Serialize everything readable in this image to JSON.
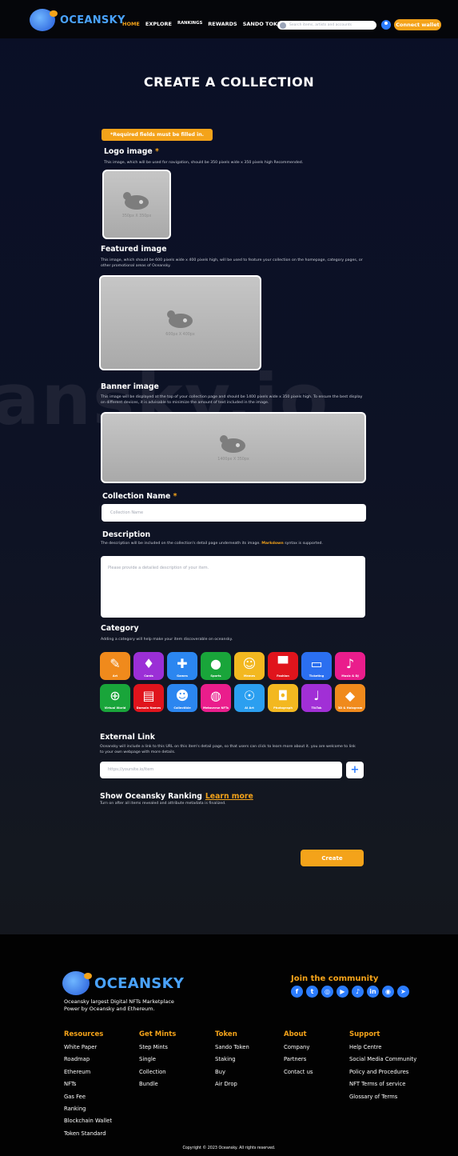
{
  "header": {
    "brand": "OCEANSKY",
    "nav": [
      {
        "label": "HOME",
        "active": true
      },
      {
        "label": "EXPLORE",
        "active": false
      },
      {
        "label": "RANKINGS",
        "active": false
      },
      {
        "label": "REWARDS",
        "active": false
      },
      {
        "label": "SANDO TOKEN",
        "active": false
      }
    ],
    "search_placeholder": "Search items, artists and accounts",
    "connect_label": "Connect wallet"
  },
  "watermark": "ansky.io",
  "page_title": "CREATE  A COLLECTION",
  "required_note": "*Required fields must be filled in.",
  "logo_image": {
    "title": "Logo image",
    "required_mark": "*",
    "desc": "This image, which will be used for navigation, should be 350 pixels wide x 350 pixels high Recommended.",
    "size_hint": "350px X 350px"
  },
  "featured_image": {
    "title": "Featured image",
    "desc": "This image, which should be 600 pixels wide x 400 pixels high, will be used to feature your collection on the homepage, category pages, or other promotional areas of Oceansky.",
    "size_hint": "600px X 400px"
  },
  "banner_image": {
    "title": "Banner image",
    "desc": "This image will be displayed at the top of your collection page and should be 1400 pixels wide x 350 pixels high. To ensure the best display on different devices, it is advisable to minimize the amount of text included in the image.",
    "size_hint": "1400px X 350px"
  },
  "collection_name": {
    "title": "Collection Name",
    "required_mark": "*",
    "placeholder": "Collection Name"
  },
  "description": {
    "title": "Description",
    "desc_before": "The description will be included on the collection's detail page underneath its image. ",
    "desc_link": "Markdown",
    "desc_after": " syntax is supported.",
    "placeholder": "Please provide a detailed description of your item."
  },
  "category": {
    "title": "Category",
    "desc": "Adding a category will help make your item discoverable on oceansky.",
    "items": [
      {
        "label": "Art",
        "color": "#f08a1c",
        "icon": "palette-icon",
        "glyph": "✎"
      },
      {
        "label": "Cards",
        "color": "#9b2fd6",
        "icon": "cards-icon",
        "glyph": "♦"
      },
      {
        "label": "Games",
        "color": "#2b86f0",
        "icon": "gamepad-icon",
        "glyph": "✚"
      },
      {
        "label": "Sports",
        "color": "#19a53a",
        "icon": "ball-icon",
        "glyph": "●"
      },
      {
        "label": "Memes",
        "color": "#f3b820",
        "icon": "doge-icon",
        "glyph": "☺"
      },
      {
        "label": "Fashion",
        "color": "#e0141c",
        "icon": "hat-icon",
        "glyph": "▀"
      },
      {
        "label": "Ticketing",
        "color": "#2b6ff0",
        "icon": "ticket-icon",
        "glyph": "▭"
      },
      {
        "label": "Music & DJ",
        "color": "#ea1d8c",
        "icon": "music-icon",
        "glyph": "♪"
      },
      {
        "label": "Virtual World",
        "color": "#19a53a",
        "icon": "globe-icon",
        "glyph": "⊕"
      },
      {
        "label": "Domain Names",
        "color": "#e0141c",
        "icon": "www-icon",
        "glyph": "▤"
      },
      {
        "label": "Collectible",
        "color": "#2b86f0",
        "icon": "bear-icon",
        "glyph": "☻"
      },
      {
        "label": "Metaverse NFTs",
        "color": "#ea1d8c",
        "icon": "vr-icon",
        "glyph": "◍"
      },
      {
        "label": "AI Art",
        "color": "#2b9ff0",
        "icon": "ai-head-icon",
        "glyph": "☉"
      },
      {
        "label": "Photograph",
        "color": "#f3b820",
        "icon": "camera-icon",
        "glyph": "◘"
      },
      {
        "label": "TikTok",
        "color": "#a12fd6",
        "icon": "tiktok-icon",
        "glyph": "♩"
      },
      {
        "label": "3D & Hologram",
        "color": "#f08a1c",
        "icon": "cube-icon",
        "glyph": "◆"
      }
    ]
  },
  "external_link": {
    "title": "External Link",
    "desc": "Oceansky will include a link to this URL on this item's detail page, so that users can click to learn more about it. you are welcome to link to your own webpage with more details.",
    "placeholder": "https://yoursite.io/item",
    "add_label": "+"
  },
  "ranking": {
    "title": "Show Oceansky Ranking",
    "learn_more": "Learn more",
    "desc": "Turn on after all items revealed and attribute metadata is finalized."
  },
  "create_label": "Create",
  "footer": {
    "brand": "OCEANSKY",
    "tagline_1": "Oceansky largest Digital NFTs Marketplace",
    "tagline_2": "Power by Oceansky and Ethereum.",
    "community_title": "Join the community",
    "socials": [
      {
        "name": "facebook-icon",
        "glyph": "f"
      },
      {
        "name": "twitter-icon",
        "glyph": "t"
      },
      {
        "name": "instagram-icon",
        "glyph": "◎"
      },
      {
        "name": "youtube-icon",
        "glyph": "▶"
      },
      {
        "name": "tiktok-icon",
        "glyph": "♪"
      },
      {
        "name": "linkedin-icon",
        "glyph": "in"
      },
      {
        "name": "discord-icon",
        "glyph": "◉"
      },
      {
        "name": "telegram-icon",
        "glyph": "➤"
      }
    ],
    "columns": [
      {
        "heading": "Resources",
        "items": [
          "White Paper",
          "Roadmap",
          "Ethereum",
          "NFTs",
          "Gas Fee",
          "Ranking",
          "Blockchain Wallet",
          "Token Standard"
        ]
      },
      {
        "heading": "Get Mints",
        "items": [
          "Step Mints",
          "Single",
          "Collection",
          "Bundle"
        ]
      },
      {
        "heading": "Token",
        "items": [
          "Sando Token",
          "Staking",
          "Buy",
          "Air Drop"
        ]
      },
      {
        "heading": "About",
        "items": [
          "Company",
          "Partners",
          "Contact us"
        ]
      },
      {
        "heading": "Support",
        "items": [
          "Help Centre",
          "Social Media Community",
          "Policy and Procedures",
          "NFT Terms of service",
          "Glossary of Terms"
        ]
      }
    ],
    "copyright": "Copyright © 2023 Oceansky. All rights reserved."
  }
}
